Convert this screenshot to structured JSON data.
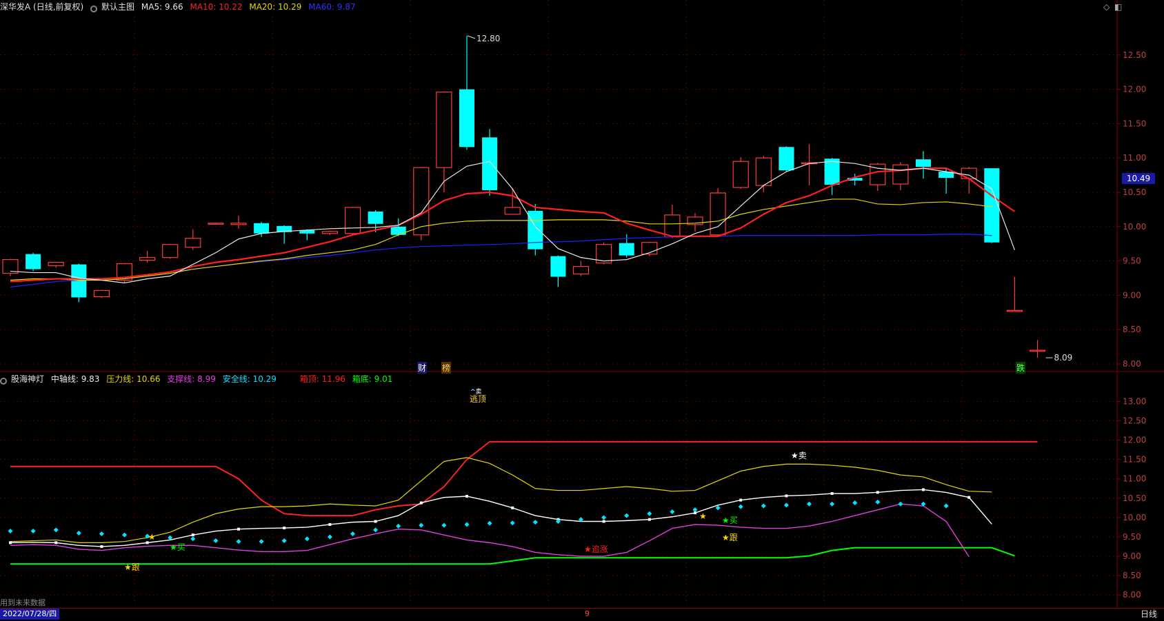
{
  "main_header": {
    "stock": "深华发A (日线,前复权)",
    "chart_name": "默认主图",
    "ma5": "MA5: 9.66",
    "ma10": "MA10: 10.22",
    "ma20": "MA20: 10.29",
    "ma60": "MA60: 9.87"
  },
  "sub_header": {
    "name": "股海神灯",
    "mid": "中轴线: 9.83",
    "pressure": "压力线: 10.66",
    "support": "支撑线: 8.99",
    "safe": "安全线: 10.29",
    "top": "箱顶: 11.96",
    "bottom": "箱底: 9.01"
  },
  "colors": {
    "up": "#ff3b3b",
    "down": "#00ffff",
    "ma5": "#e8e8e8",
    "ma10": "#ff2020",
    "ma20": "#e6d800",
    "ma60": "#2020ff",
    "axis": "#8b0000",
    "grid": "#5a0000",
    "support": "#e040e0",
    "safe": "#00e5ff",
    "boxbottom": "#00ff00"
  },
  "axis": {
    "main_ticks": [
      "12.50",
      "12.00",
      "11.50",
      "11.00",
      "10.50",
      "10.00",
      "9.50",
      "9.00",
      "8.50",
      "8.00"
    ],
    "sub_ticks": [
      "13.00",
      "12.50",
      "12.00",
      "11.50",
      "11.00",
      "10.50",
      "10.00",
      "9.50",
      "9.00",
      "8.50",
      "8.00"
    ],
    "current_price": "10.49",
    "high_label": "12.80",
    "low_label": "8.09"
  },
  "markers": {
    "cai": "财",
    "bang": "榜",
    "die": "跌",
    "escape": "逃顶",
    "escape_icon": "^卖",
    "sell": "★卖",
    "buy1": "★买",
    "buy2": "★买",
    "follow1": "★跟",
    "follow2": "★跟",
    "chase": "★追涨",
    "star": "★"
  },
  "footer": {
    "note": "用到未来数据",
    "date": "2022/07/28/四",
    "timeframe": "日线",
    "cursor_mark": "9"
  },
  "chart_data": {
    "type": "candlestick",
    "main_ylim": [
      7.9,
      13.1
    ],
    "sub_ylim": [
      7.7,
      13.4
    ],
    "candles": [
      [
        9.32,
        9.52,
        9.53,
        9.28
      ],
      [
        9.6,
        9.38,
        9.62,
        9.35
      ],
      [
        9.43,
        9.48,
        9.49,
        9.4
      ],
      [
        9.45,
        8.97,
        9.46,
        8.9
      ],
      [
        8.98,
        9.07,
        9.08,
        8.96
      ],
      [
        9.22,
        9.46,
        9.47,
        9.18
      ],
      [
        9.51,
        9.55,
        9.65,
        9.48
      ],
      [
        9.55,
        9.74,
        9.75,
        9.53
      ],
      [
        9.7,
        9.83,
        9.96,
        9.66
      ],
      [
        10.05,
        10.05,
        10.06,
        10.04
      ],
      [
        10.03,
        10.05,
        10.16,
        9.97
      ],
      [
        10.05,
        9.9,
        10.07,
        9.85
      ],
      [
        10.01,
        9.92,
        10.02,
        9.75
      ],
      [
        9.95,
        9.9,
        9.96,
        9.8
      ],
      [
        9.9,
        9.93,
        9.94,
        9.88
      ],
      [
        9.9,
        10.28,
        10.29,
        9.88
      ],
      [
        10.22,
        10.04,
        10.24,
        9.92
      ],
      [
        10.0,
        9.88,
        10.12,
        9.86
      ],
      [
        9.88,
        10.86,
        10.87,
        9.8
      ],
      [
        10.86,
        11.96,
        11.97,
        10.5
      ],
      [
        12.0,
        11.16,
        12.78,
        11.12
      ],
      [
        11.3,
        10.53,
        11.42,
        10.45
      ],
      [
        10.18,
        10.28,
        10.56,
        10.18
      ],
      [
        10.23,
        9.67,
        10.33,
        9.58
      ],
      [
        9.57,
        9.27,
        9.58,
        9.12
      ],
      [
        9.31,
        9.42,
        9.5,
        9.28
      ],
      [
        9.47,
        9.74,
        9.77,
        9.45
      ],
      [
        9.76,
        9.58,
        9.89,
        9.55
      ],
      [
        9.6,
        9.77,
        9.78,
        9.57
      ],
      [
        9.85,
        10.17,
        10.32,
        9.83
      ],
      [
        10.03,
        10.14,
        10.2,
        9.93
      ],
      [
        9.88,
        10.49,
        10.56,
        9.86
      ],
      [
        10.57,
        10.95,
        11.01,
        10.55
      ],
      [
        10.6,
        11.0,
        11.03,
        10.5
      ],
      [
        11.16,
        10.82,
        11.17,
        10.8
      ],
      [
        10.93,
        10.93,
        11.2,
        10.6
      ],
      [
        10.99,
        10.61,
        11.0,
        10.46
      ],
      [
        10.71,
        10.67,
        10.77,
        10.6
      ],
      [
        10.61,
        10.91,
        10.93,
        10.52
      ],
      [
        10.62,
        10.9,
        10.94,
        10.53
      ],
      [
        10.98,
        10.87,
        11.1,
        10.7
      ],
      [
        10.8,
        10.71,
        10.85,
        10.48
      ],
      [
        10.7,
        10.85,
        10.87,
        10.48
      ],
      [
        10.85,
        9.77,
        10.85,
        9.76
      ],
      [
        8.78,
        8.78,
        9.27,
        8.78
      ],
      [
        8.2,
        8.2,
        8.35,
        8.09
      ]
    ],
    "ma5": [
      9.35,
      9.33,
      9.33,
      9.25,
      9.22,
      9.18,
      9.24,
      9.28,
      9.45,
      9.62,
      9.82,
      9.9,
      9.93,
      9.95,
      9.97,
      9.98,
      9.99,
      10.02,
      10.2,
      10.66,
      10.88,
      10.95,
      10.55,
      10.0,
      9.68,
      9.55,
      9.5,
      9.52,
      9.62,
      9.75,
      9.9,
      10.0,
      10.3,
      10.6,
      10.8,
      10.92,
      10.95,
      10.92,
      10.85,
      10.82,
      10.85,
      10.8,
      10.75,
      10.55,
      9.66
    ],
    "ma10": [
      9.2,
      9.22,
      9.24,
      9.24,
      9.24,
      9.26,
      9.3,
      9.34,
      9.42,
      9.48,
      9.52,
      9.57,
      9.62,
      9.7,
      9.78,
      9.88,
      9.95,
      10.02,
      10.18,
      10.38,
      10.48,
      10.5,
      10.45,
      10.28,
      10.25,
      10.22,
      10.2,
      10.05,
      9.95,
      9.86,
      9.86,
      9.86,
      9.98,
      10.18,
      10.35,
      10.45,
      10.6,
      10.72,
      10.8,
      10.82,
      10.85,
      10.85,
      10.7,
      10.45,
      10.22
    ],
    "ma20": [
      9.22,
      9.24,
      9.24,
      9.22,
      9.22,
      9.24,
      9.28,
      9.32,
      9.38,
      9.42,
      9.46,
      9.5,
      9.53,
      9.58,
      9.62,
      9.66,
      9.74,
      9.88,
      10.0,
      10.05,
      10.08,
      10.09,
      10.09,
      10.09,
      10.1,
      10.1,
      10.1,
      10.08,
      10.04,
      10.04,
      10.05,
      10.08,
      10.18,
      10.25,
      10.3,
      10.35,
      10.4,
      10.4,
      10.33,
      10.32,
      10.35,
      10.36,
      10.33,
      10.29
    ],
    "ma60": [
      9.12,
      9.16,
      9.2,
      9.22,
      9.24,
      9.26,
      9.3,
      9.34,
      9.38,
      9.42,
      9.46,
      9.49,
      9.52,
      9.55,
      9.58,
      9.62,
      9.66,
      9.69,
      9.71,
      9.72,
      9.73,
      9.74,
      9.75,
      9.77,
      9.78,
      9.79,
      9.81,
      9.83,
      9.84,
      9.85,
      9.86,
      9.86,
      9.87,
      9.87,
      9.87,
      9.87,
      9.87,
      9.87,
      9.88,
      9.88,
      9.88,
      9.89,
      9.89,
      9.87
    ],
    "sub_box_top": [
      11.32,
      11.32,
      11.32,
      11.32,
      11.32,
      11.32,
      11.32,
      11.32,
      11.32,
      11.32,
      11.0,
      10.45,
      10.1,
      10.05,
      10.05,
      10.05,
      10.2,
      10.3,
      10.35,
      10.8,
      11.5,
      11.96,
      11.96,
      11.96,
      11.96,
      11.96,
      11.96,
      11.96,
      11.96,
      11.96,
      11.96,
      11.96,
      11.96,
      11.96,
      11.96,
      11.96,
      11.96,
      11.96,
      11.96,
      11.96,
      11.96,
      11.96,
      11.96,
      11.96,
      11.96,
      11.96
    ],
    "sub_pressure": [
      9.38,
      9.4,
      9.42,
      9.35,
      9.35,
      9.38,
      9.48,
      9.62,
      9.88,
      10.1,
      10.22,
      10.28,
      10.28,
      10.3,
      10.35,
      10.32,
      10.3,
      10.45,
      10.95,
      11.45,
      11.55,
      11.4,
      11.1,
      10.75,
      10.7,
      10.7,
      10.75,
      10.8,
      10.75,
      10.68,
      10.7,
      10.95,
      11.2,
      11.32,
      11.38,
      11.38,
      11.35,
      11.3,
      11.22,
      11.1,
      11.05,
      10.85,
      10.68,
      10.66
    ],
    "sub_mid": [
      9.35,
      9.36,
      9.35,
      9.28,
      9.25,
      9.28,
      9.35,
      9.42,
      9.55,
      9.65,
      9.7,
      9.72,
      9.73,
      9.75,
      9.82,
      9.88,
      9.9,
      10.05,
      10.38,
      10.52,
      10.55,
      10.42,
      10.25,
      10.05,
      9.95,
      9.9,
      9.9,
      9.92,
      9.95,
      10.02,
      10.12,
      10.32,
      10.45,
      10.52,
      10.56,
      10.58,
      10.62,
      10.62,
      10.65,
      10.7,
      10.72,
      10.65,
      10.52,
      9.83
    ],
    "sub_support": [
      9.28,
      9.3,
      9.28,
      9.18,
      9.15,
      9.22,
      9.26,
      9.28,
      9.28,
      9.22,
      9.16,
      9.12,
      9.12,
      9.15,
      9.3,
      9.45,
      9.58,
      9.7,
      9.68,
      9.55,
      9.42,
      9.35,
      9.25,
      9.1,
      9.04,
      9.0,
      9.0,
      9.1,
      9.4,
      9.72,
      9.82,
      9.8,
      9.75,
      9.72,
      9.72,
      9.78,
      9.9,
      10.05,
      10.2,
      10.35,
      10.3,
      9.9,
      8.99
    ],
    "sub_safe": [
      9.65,
      9.65,
      9.68,
      9.6,
      9.58,
      9.55,
      9.52,
      9.48,
      9.45,
      9.4,
      9.38,
      9.38,
      9.4,
      9.45,
      9.5,
      9.58,
      9.68,
      9.78,
      9.8,
      9.8,
      9.82,
      9.85,
      9.86,
      9.88,
      9.9,
      9.95,
      10.0,
      10.05,
      10.1,
      10.15,
      10.2,
      10.25,
      10.28,
      10.3,
      10.32,
      10.35,
      10.35,
      10.38,
      10.4,
      10.35,
      10.35,
      10.3
    ],
    "sub_box_bottom": [
      8.8,
      8.8,
      8.8,
      8.8,
      8.8,
      8.8,
      8.8,
      8.8,
      8.8,
      8.8,
      8.8,
      8.8,
      8.8,
      8.8,
      8.8,
      8.8,
      8.8,
      8.8,
      8.8,
      8.8,
      8.8,
      8.8,
      8.88,
      8.96,
      8.96,
      8.96,
      8.96,
      8.96,
      8.96,
      8.96,
      8.96,
      8.96,
      8.96,
      8.96,
      8.96,
      9.01,
      9.15,
      9.22,
      9.22,
      9.22,
      9.22,
      9.22,
      9.22,
      9.22,
      9.01
    ]
  }
}
